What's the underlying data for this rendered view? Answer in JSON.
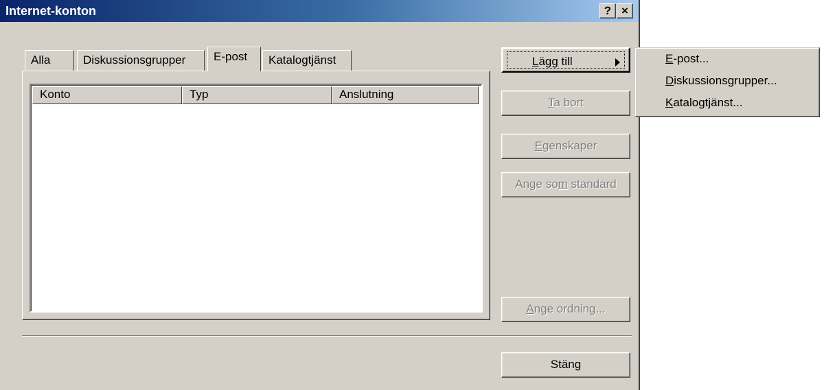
{
  "window": {
    "title": "Internet-konton",
    "help_button": "?",
    "close_button": "×"
  },
  "tabs": [
    {
      "label": "Alla",
      "selected": false
    },
    {
      "label": "Diskussionsgrupper",
      "selected": false
    },
    {
      "label": "E-post",
      "selected": true
    },
    {
      "label": "Katalogtjänst",
      "selected": false
    }
  ],
  "list": {
    "columns": [
      "Konto",
      "Typ",
      "Anslutning"
    ],
    "rows": []
  },
  "buttons": {
    "add": {
      "label_mnemonic": "L",
      "label_rest": "ägg till"
    },
    "remove": {
      "label_mnemonic": "T",
      "label_rest": "a bort"
    },
    "properties": {
      "label_mnemonic": "E",
      "label_rest": "genskaper"
    },
    "set_default": {
      "label_pre": "Ange so",
      "label_mnemonic": "m",
      "label_rest": " standard"
    },
    "set_order": {
      "label_mnemonic": "A",
      "label_rest": "nge ordning..."
    },
    "close": {
      "label": "Stäng"
    }
  },
  "popup_menu": {
    "items": [
      {
        "mnemonic": "E",
        "rest": "-post..."
      },
      {
        "mnemonic": "D",
        "rest": "iskussionsgrupper..."
      },
      {
        "mnemonic": "K",
        "rest": "atalogtjänst..."
      }
    ]
  },
  "icons": {
    "submenu_arrow": "arrow-right-icon"
  }
}
